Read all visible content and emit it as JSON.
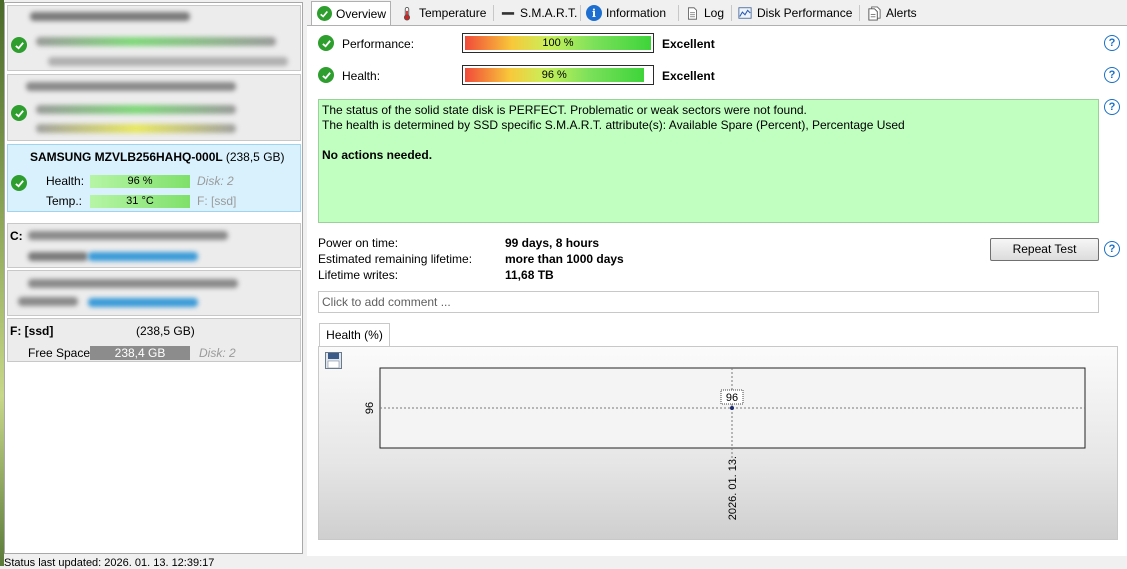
{
  "left_panel": {
    "selected_disk": {
      "name": "SAMSUNG MZVLB256HAHQ-000L",
      "size": "(238,5 GB)",
      "health_label": "Health:",
      "health_value": "96 %",
      "health_pct": 96,
      "disk_label": "Disk: 2",
      "temp_label": "Temp.:",
      "temp_value": "31 °C",
      "drive_label": "F: [ssd]"
    },
    "partition_c": {
      "label": "C:"
    },
    "partition_f": {
      "label": "F: [ssd]",
      "size": "(238,5 GB)",
      "free_label": "Free Space",
      "free_value": "238,4 GB",
      "disk_label": "Disk: 2"
    },
    "status_line": "Status last updated: 2026. 01. 13. 12:39:17"
  },
  "tabs": [
    {
      "label": "Overview",
      "icon": "ok-check-icon",
      "active": true
    },
    {
      "label": "Temperature",
      "icon": "thermometer-icon"
    },
    {
      "label": "S.M.A.R.T.",
      "icon": "dash-icon"
    },
    {
      "label": "Information",
      "icon": "info-icon"
    },
    {
      "label": "Log",
      "icon": "document-icon"
    },
    {
      "label": "Disk Performance",
      "icon": "chart-icon"
    },
    {
      "label": "Alerts",
      "icon": "documents-icon"
    }
  ],
  "overview": {
    "performance": {
      "label": "Performance:",
      "bar_text": "100 %",
      "pct": 100,
      "rating": "Excellent"
    },
    "health": {
      "label": "Health:",
      "bar_text": "96 %",
      "pct": 96,
      "rating": "Excellent"
    },
    "status_lines": [
      "The status of the solid state disk is PERFECT. Problematic or weak sectors were not found.",
      "The health is determined by SSD specific S.M.A.R.T. attribute(s):  Available Spare (Percent), Percentage Used"
    ],
    "status_action": "No actions needed.",
    "status_color": "#c0ffc0",
    "power_on_label": "Power on time:",
    "power_on_value": "99 days, 8 hours",
    "remaining_label": "Estimated remaining lifetime:",
    "remaining_value": "more than 1000 days",
    "writes_label": "Lifetime writes:",
    "writes_value": "11,68 TB",
    "repeat_button": "Repeat Test",
    "comment_placeholder": "Click to add comment ...",
    "help_icon": "?"
  },
  "chart_data": {
    "type": "line",
    "tab_label": "Health (%)",
    "x": [
      "2026. 01. 13."
    ],
    "series": [
      {
        "values": [
          96
        ]
      }
    ],
    "y_tick_labels": [
      "96"
    ],
    "data_labels": [
      "96"
    ],
    "grid": true
  }
}
